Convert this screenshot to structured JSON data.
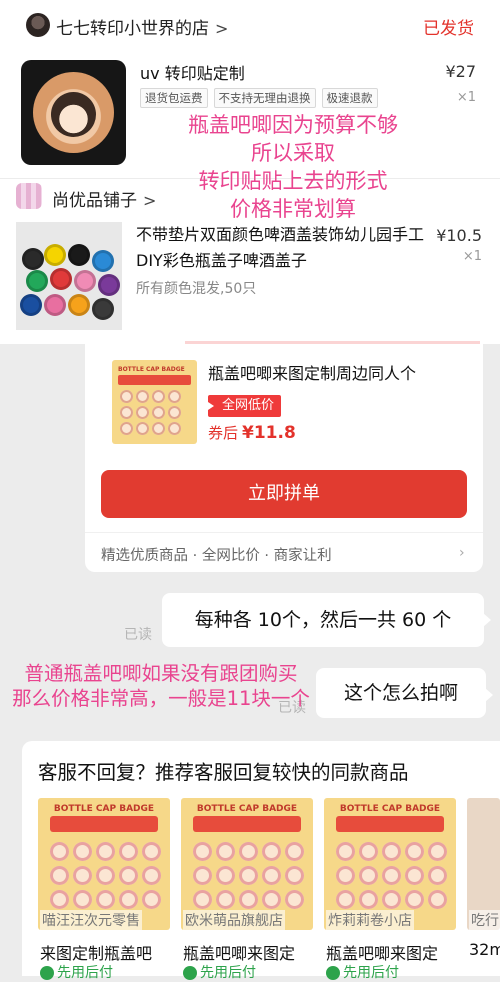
{
  "order_card": {
    "shop_name": "七七转印小世界的店",
    "status": "已发货",
    "product_title": "uv 转印贴定制",
    "price": "¥27",
    "tags": [
      "退货包运费",
      "不支持无理由退换",
      "极速退款"
    ],
    "quantity": "×1"
  },
  "annotation_top": {
    "lines": [
      "瓶盖吧唧因为预算不够",
      "所以采取",
      "转印贴贴上去的形式",
      "价格非常划算"
    ],
    "color": "#e9448f"
  },
  "second_shop": {
    "shop_name": "尚优品铺子",
    "product_title": "不带垫片双面颜色啤酒盖装饰幼儿园手工DIY彩色瓶盖子啤酒盖子",
    "price": "¥10.5",
    "quantity": "×1",
    "spec": "所有颜色混发,50只"
  },
  "group_buy": {
    "product_title": "瓶盖吧唧来图定制周边同人个",
    "low_price_tag": "全网低价",
    "coupon_label": "券后",
    "coupon_price": "¥11.8",
    "join_button": "立即拼单",
    "footer": "精选优质商品 · 全网比价 · 商家让利",
    "accent": "#e13b30"
  },
  "chat": {
    "read_label": "已读",
    "message1": "每种各 10个，然后一共 60 个",
    "message2": "这个怎么拍啊",
    "read_label2": "已读"
  },
  "annotation_bottom": {
    "lines": [
      "普通瓶盖吧唧如果没有跟团购买",
      "那么价格非常高，一般是11块一个"
    ]
  },
  "recommend": {
    "title": "客服不回复？推荐客服回复较快的同款商品",
    "items": [
      {
        "image_header": "BOTTLE CAP BADGE",
        "shop": "喵汪汪次元零售",
        "name": "来图定制瓶盖吧",
        "pay": "先用后付"
      },
      {
        "image_header": "BOTTLE CAP BADGE",
        "shop": "欧米萌品旗舰店",
        "name": "瓶盖吧唧来图定",
        "pay": "先用后付"
      },
      {
        "image_header": "BOTTLE CAP BADGE",
        "shop": "炸莉莉卷小店",
        "name": "瓶盖吧唧来图定",
        "pay": "先用后付"
      },
      {
        "image_header": "",
        "shop": "吃行",
        "name": "32m",
        "pay": ""
      }
    ]
  }
}
